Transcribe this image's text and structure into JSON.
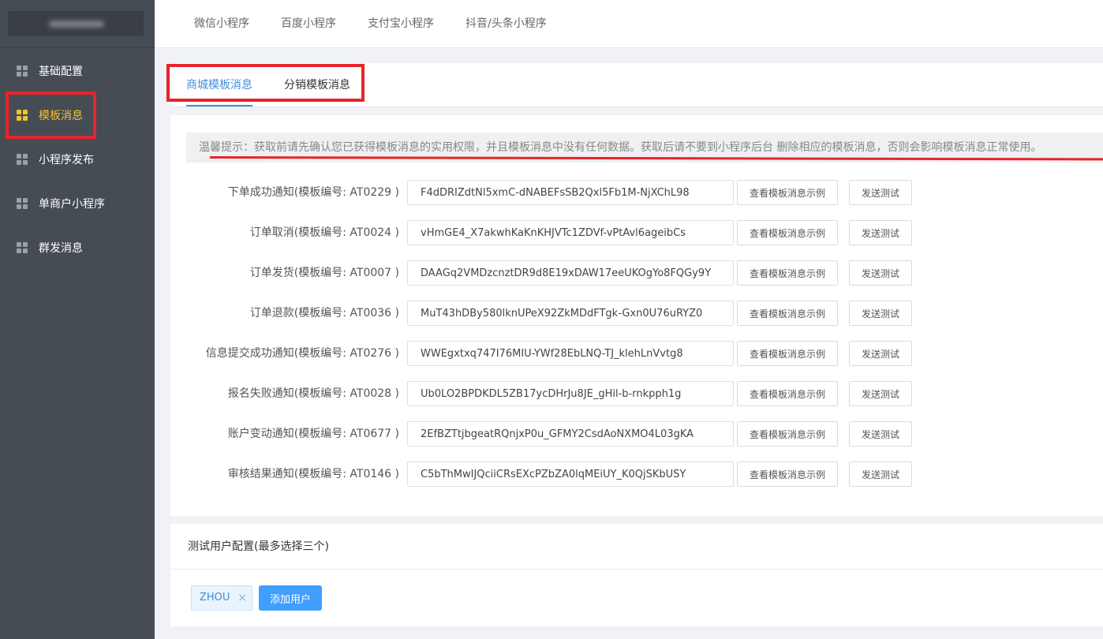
{
  "sidebar": {
    "items": [
      {
        "label": "基础配置",
        "active": false
      },
      {
        "label": "模板消息",
        "active": true
      },
      {
        "label": "小程序发布",
        "active": false
      },
      {
        "label": "单商户小程序",
        "active": false
      },
      {
        "label": "群发消息",
        "active": false
      }
    ]
  },
  "top_tabs": [
    "微信小程序",
    "百度小程序",
    "支付宝小程序",
    "抖音/头条小程序"
  ],
  "sub_tabs": [
    {
      "label": "商城模板消息",
      "active": true
    },
    {
      "label": "分销模板消息",
      "active": false
    }
  ],
  "tip": "温馨提示：获取前请先确认您已获得模板消息的实用权限，并且模板消息中没有任何数据。获取后请不要到小程序后台 删除相应的模板消息，否则会影响模板消息正常使用。",
  "templates": [
    {
      "label": "下单成功通知(模板编号: AT0229 )",
      "value": "F4dDRIZdtNl5xmC-dNABEFsSB2Qxl5Fb1M-NjXChL98"
    },
    {
      "label": "订单取消(模板编号: AT0024 )",
      "value": "vHmGE4_X7akwhKaKnKHJVTc1ZDVf-vPtAvl6ageibCs"
    },
    {
      "label": "订单发货(模板编号: AT0007 )",
      "value": "DAAGq2VMDzcnztDR9d8E19xDAW17eeUKOgYo8FQGy9Y"
    },
    {
      "label": "订单退款(模板编号: AT0036 )",
      "value": "MuT43hDBy580lknUPeX92ZkMDdFTgk-Gxn0U76uRYZ0"
    },
    {
      "label": "信息提交成功通知(模板编号: AT0276 )",
      "value": "WWEgxtxq747I76MIU-YWf28EbLNQ-TJ_klehLnVvtg8"
    },
    {
      "label": "报名失败通知(模板编号: AT0028 )",
      "value": "Ub0LO2BPDKDL5ZB17ycDHrJu8JE_gHil-b-rnkpph1g"
    },
    {
      "label": "账户变动通知(模板编号: AT0677 )",
      "value": "2EfBZTtjbgeatRQnjxP0u_GFMY2CsdAoNXMO4L03gKA"
    },
    {
      "label": "审核结果通知(模板编号: AT0146 )",
      "value": "C5bThMwIJQciiCRsEXcPZbZA0lqMEiUY_K0QjSKbUSY"
    }
  ],
  "buttons": {
    "view_example": "查看模板消息示例",
    "send_test": "发送测试",
    "add_user": "添加用户"
  },
  "test_users": {
    "title": "测试用户配置(最多选择三个)",
    "tags": [
      "ZHOU"
    ],
    "close_glyph": "×"
  },
  "colors": {
    "sidebar_bg": "#464c54",
    "active_accent": "#f2c12e",
    "primary": "#409eff",
    "tab_active": "#3f8fd6",
    "highlight": "#e8242a"
  }
}
